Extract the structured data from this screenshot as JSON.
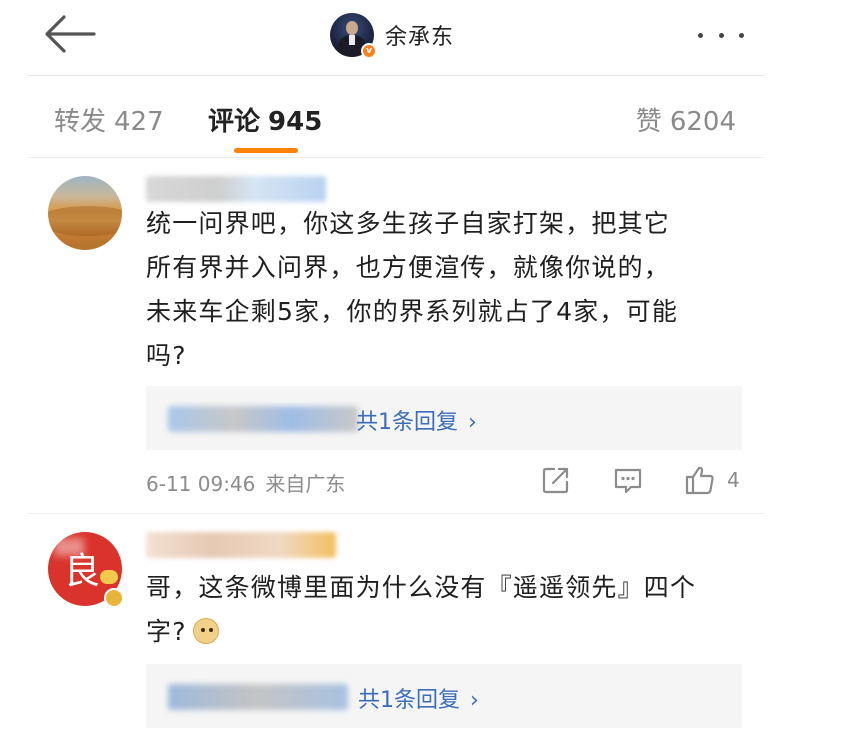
{
  "header": {
    "author_name": "余承东",
    "verified_badge": "v",
    "back_icon": "arrow-left-icon",
    "more_icon": "more-dots-icon"
  },
  "tabs": [
    {
      "label": "转发",
      "count": "427"
    },
    {
      "label": "评论",
      "count": "945"
    },
    {
      "label": "赞",
      "count": "6204"
    }
  ],
  "comments": [
    {
      "text_lines": [
        "统一问界吧，你这多生孩子自家打架，把其它",
        "所有界并入问界，也方便渲传，就像你说的，",
        "未来车企剩5家，你的界系列就占了4家，可能",
        "吗?"
      ],
      "reply_link": "共1条回复",
      "timestamp": "6-11 09:46",
      "location": "来自广东",
      "like_count": "4"
    },
    {
      "text_lines": [
        "哥，这条微博里面为什么没有『遥遥领先』四个",
        "字?"
      ],
      "avatar_glyph": "良",
      "reply_link": "共1条回复"
    }
  ],
  "colors": {
    "accent": "#ff8200",
    "link": "#3c6db8",
    "muted": "#8c8c8c"
  }
}
